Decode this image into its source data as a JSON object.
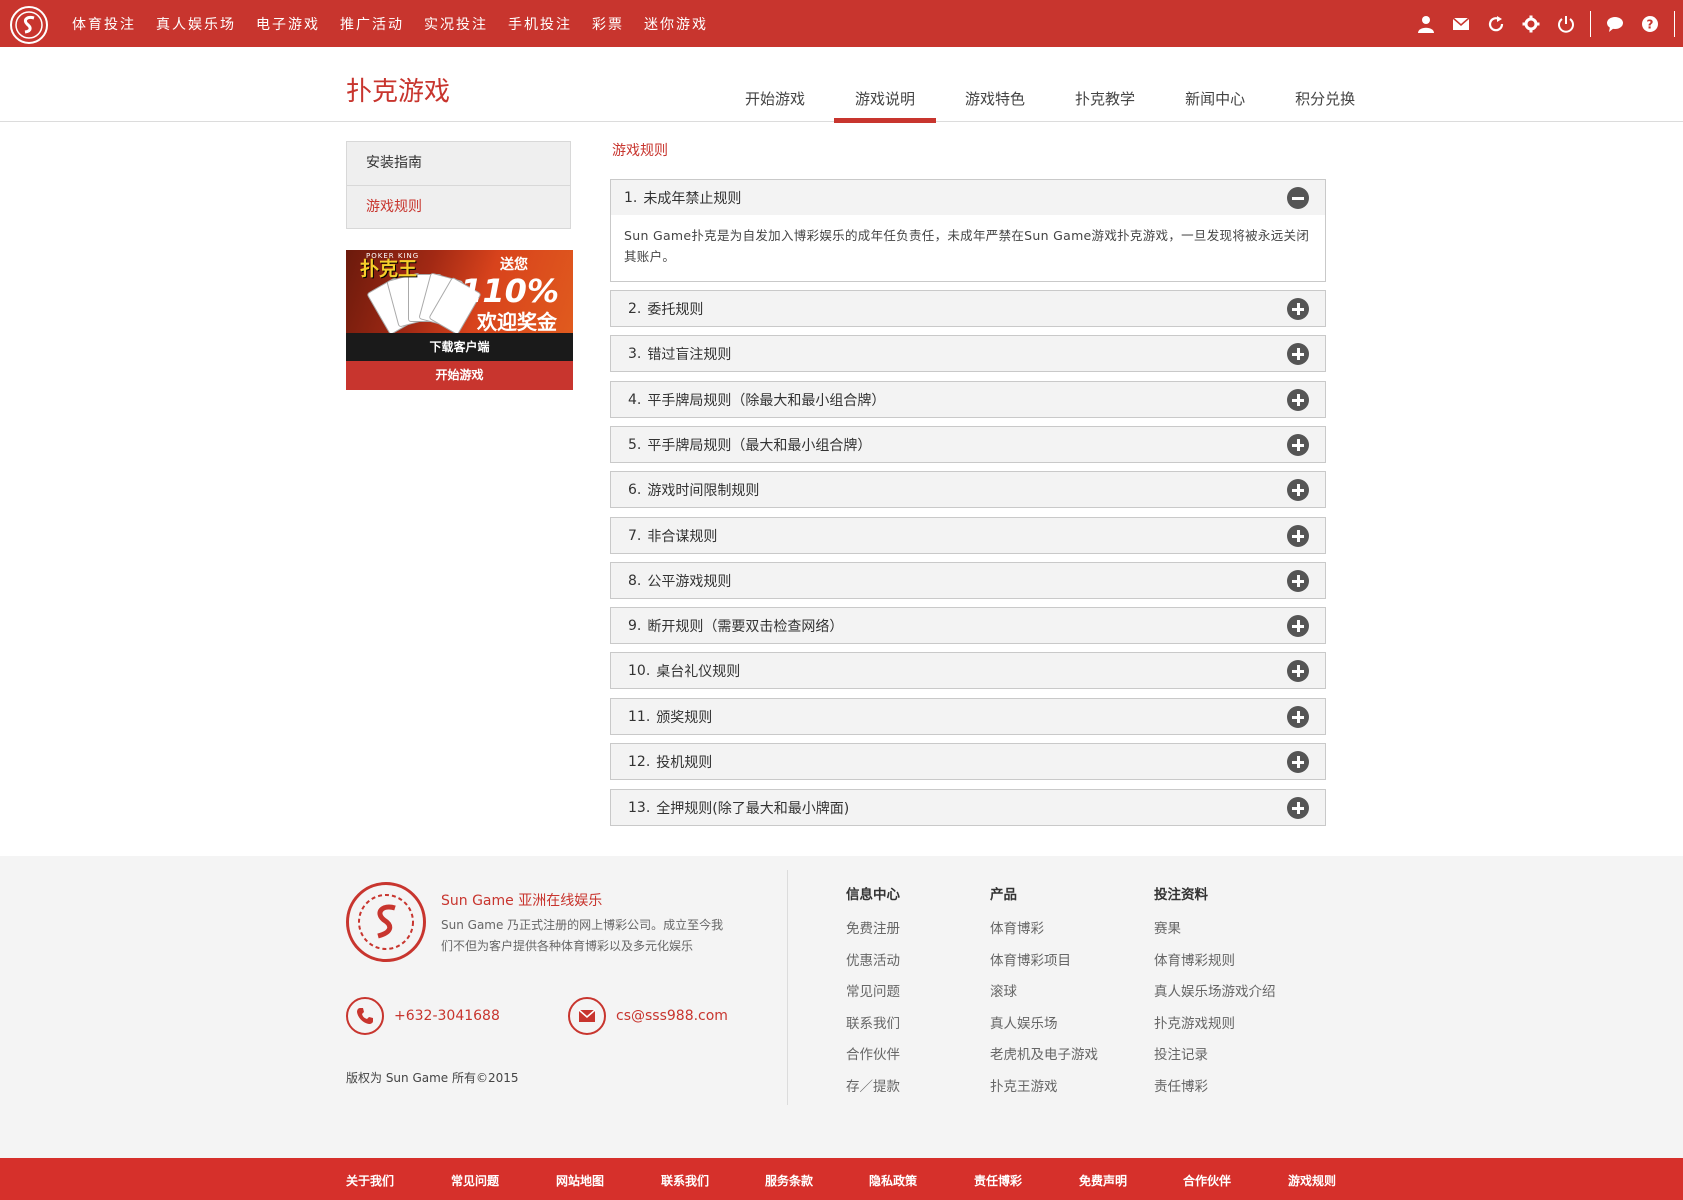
{
  "topnav": {
    "items": [
      "体育投注",
      "真人娱乐场",
      "电子游戏",
      "推广活动",
      "实况投注",
      "手机投注",
      "彩票",
      "迷你游戏"
    ],
    "icons": [
      "user-icon",
      "mail-icon",
      "refresh-icon",
      "gear-icon",
      "power-icon",
      "chat-icon",
      "help-icon"
    ]
  },
  "header": {
    "title": "扑克游戏",
    "tabs": [
      "开始游戏",
      "游戏说明",
      "游戏特色",
      "扑克教学",
      "新闻中心",
      "积分兑换"
    ],
    "active_tab": "游戏说明"
  },
  "sidebar": {
    "items": [
      "安装指南",
      "游戏规则"
    ],
    "active": "游戏规则"
  },
  "promo": {
    "brand": "扑克王",
    "brand_sub": "POKER KING",
    "gift": "送您",
    "percent": "110%",
    "bonus": "欢迎奖金",
    "download": "下载客户端",
    "play": "开始游戏"
  },
  "main": {
    "section_title": "游戏规则",
    "rules": [
      {
        "num": "1.",
        "title": "未成年禁止规则",
        "open": true,
        "body": "Sun Game扑克是为自发加入博彩娱乐的成年任负责任，未成年严禁在Sun Game游戏扑克游戏，一旦发现将被永远关闭其账户。"
      },
      {
        "num": "2.",
        "title": "委托规则"
      },
      {
        "num": "3.",
        "title": "错过盲注规则"
      },
      {
        "num": "4.",
        "title": "平手牌局规则（除最大和最小组合牌）"
      },
      {
        "num": "5.",
        "title": "平手牌局规则（最大和最小组合牌）"
      },
      {
        "num": "6.",
        "title": "游戏时间限制规则"
      },
      {
        "num": "7.",
        "title": "非合谋规则"
      },
      {
        "num": "8.",
        "title": "公平游戏规则"
      },
      {
        "num": "9.",
        "title": "断开规则（需要双击检查网络）"
      },
      {
        "num": "10.",
        "title": "桌台礼仪规则"
      },
      {
        "num": "11.",
        "title": "颁奖规则"
      },
      {
        "num": "12.",
        "title": "投机规则"
      },
      {
        "num": "13.",
        "title": "全押规则(除了最大和最小牌面)"
      }
    ]
  },
  "footer": {
    "brand": "Sun Game 亚洲在线娱乐",
    "desc": "Sun Game 乃正式注册的网上博彩公司。成立至今我们不但为客户提供各种体育博彩以及多元化娱乐",
    "phone": "+632-3041688",
    "email": "cs@sss988.com",
    "copyright": "版权为 Sun Game 所有©2015",
    "columns": [
      {
        "title": "信息中心",
        "links": [
          "免费注册",
          "优惠活动",
          "常见问题",
          "联系我们",
          "合作伙伴",
          "存／提款"
        ]
      },
      {
        "title": "产品",
        "links": [
          "体育博彩",
          "体育博彩项目",
          "滚球",
          "真人娱乐场",
          "老虎机及电子游戏",
          "扑克王游戏"
        ]
      },
      {
        "title": "投注资料",
        "links": [
          "赛果",
          "体育博彩规则",
          "真人娱乐场游戏介绍",
          "扑克游戏规则",
          "投注记录",
          "责任博彩"
        ]
      }
    ],
    "bottom_links": [
      "关于我们",
      "常见问题",
      "网站地图",
      "联系我们",
      "服务条款",
      "隐私政策",
      "责任博彩",
      "免费声明",
      "合作伙伴",
      "游戏规则"
    ]
  },
  "colors": {
    "brand_red": "#c8352e",
    "bottom_red": "#d6302b",
    "footer_bg": "#f4f4f4"
  }
}
